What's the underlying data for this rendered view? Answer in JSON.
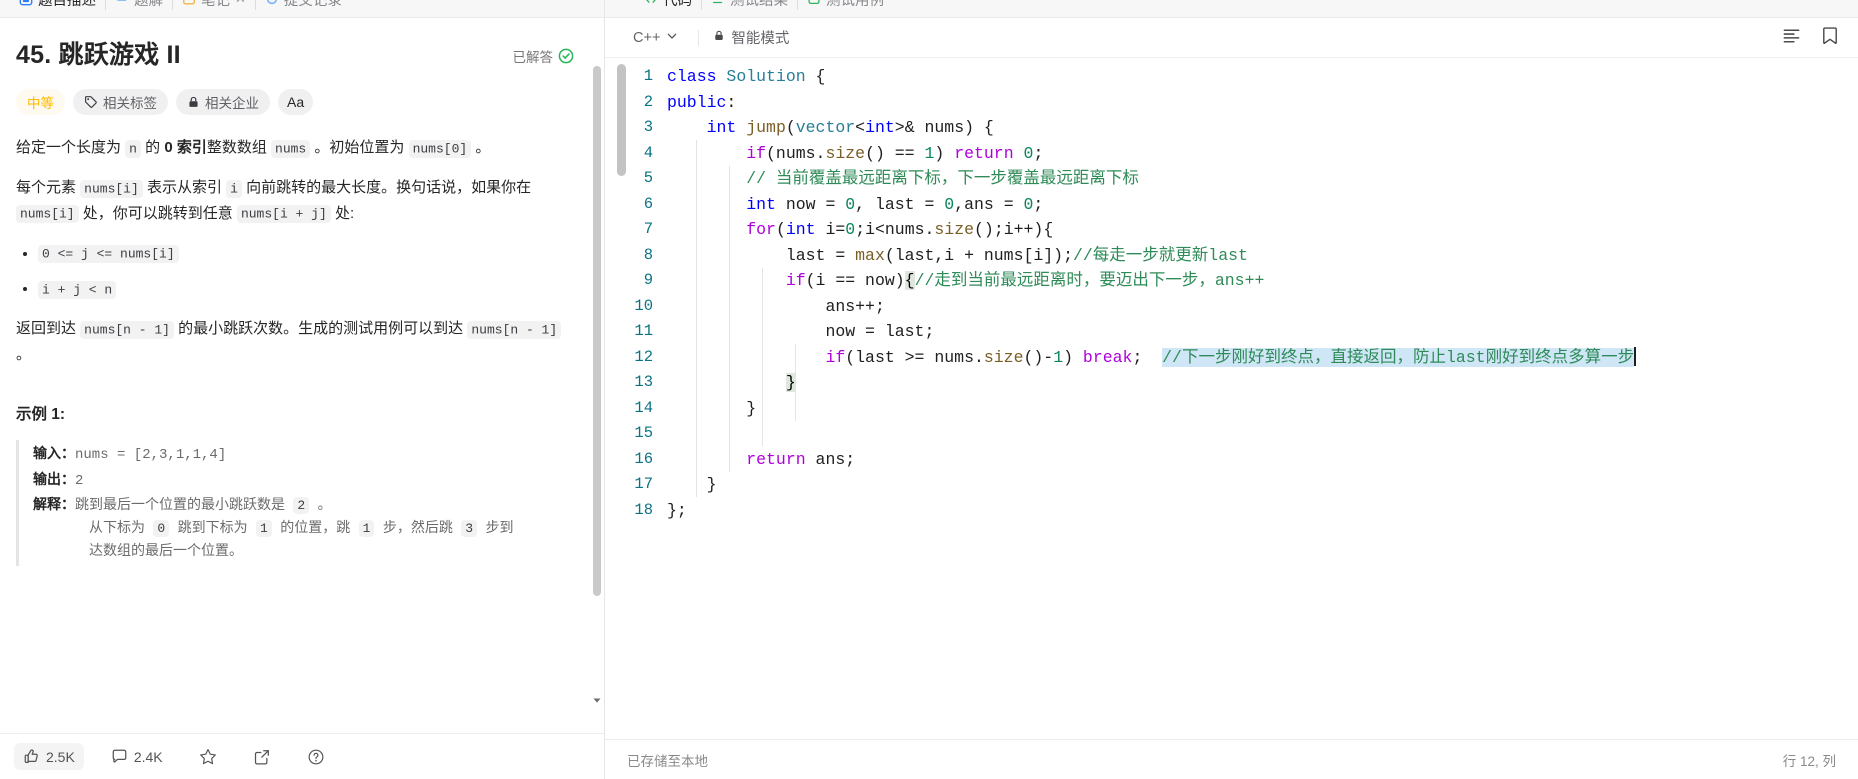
{
  "left_tabs": [
    {
      "label": "题目描述",
      "icon": "description-icon",
      "active": true
    },
    {
      "label": "题解",
      "icon": "solution-icon",
      "active": false
    },
    {
      "label": "笔记",
      "icon": "note-icon",
      "active": false
    },
    {
      "label": "提交记录",
      "icon": "history-icon",
      "active": false
    }
  ],
  "right_tabs": [
    {
      "label": "代码",
      "icon": "code-icon",
      "active": true
    },
    {
      "label": "测试结果",
      "icon": "test-result-icon",
      "active": false
    },
    {
      "label": "测试用例",
      "icon": "test-case-icon",
      "active": false
    }
  ],
  "problem": {
    "title": "45. 跳跃游戏 II",
    "solved_label": "已解答",
    "badges": [
      {
        "label": "中等",
        "icon": null,
        "kind": "difficulty"
      },
      {
        "label": "相关标签",
        "icon": "tag-icon",
        "kind": "normal"
      },
      {
        "label": "相关企业",
        "icon": "lock-icon",
        "kind": "normal"
      },
      {
        "label": "Aa",
        "icon": null,
        "kind": "font"
      }
    ],
    "paragraph1": {
      "t1": "给定一个长度为 ",
      "c1": "n",
      "t2": " 的 ",
      "b1": "0 索引",
      "t3": "整数数组 ",
      "c2": "nums",
      "t4": " 。初始位置为 ",
      "c3": "nums[0]",
      "t5": " 。"
    },
    "paragraph2": {
      "t1": "每个元素 ",
      "c1": "nums[i]",
      "t2": " 表示从索引 ",
      "c2": "i",
      "t3": " 向前跳转的最大长度。换句话说，如果你在 ",
      "c3": "nums[i]",
      "t4": " 处，你可以跳转到任意 ",
      "c4": "nums[i + j]",
      "t5": " 处:"
    },
    "bullets": [
      "0 <= j <= nums[i]",
      "i + j < n"
    ],
    "paragraph3": {
      "t1": "返回到达 ",
      "c1": "nums[n - 1]",
      "t2": " 的最小跳跃次数。生成的测试用例可以到达 ",
      "c2": "nums[n - 1]",
      "t3": " 。"
    },
    "example_title": "示例 1:",
    "example": {
      "input_label": "输入：",
      "input_value": "nums = [2,3,1,1,4]",
      "output_label": "输出：",
      "output_value": "2",
      "explain_label": "解释：",
      "explain_line1_a": "跳到最后一个位置的最小跳跃数是 ",
      "explain_line1_chip": "2",
      "explain_line1_b": " 。",
      "explain_line2_a": "从下标为 ",
      "explain_line2_c1": "0",
      "explain_line2_b": " 跳到下标为 ",
      "explain_line2_c2": "1",
      "explain_line2_c": " 的位置，跳 ",
      "explain_line2_c3": "1",
      "explain_line2_d": " 步，然后跳 ",
      "explain_line2_c4": "3",
      "explain_line2_e": " 步到",
      "explain_line3": "达数组的最后一个位置。"
    }
  },
  "footer": {
    "likes": "2.5K",
    "comments": "2.4K",
    "star_icon": "star-icon",
    "share_icon": "share-icon",
    "help_icon": "help-icon"
  },
  "editor": {
    "language": "C++",
    "smart_mode": "智能模式",
    "lock_icon": "lock-icon",
    "chevron_icon": "chevron-down-icon",
    "format_icon": "format-list-icon",
    "bookmark_icon": "bookmark-icon",
    "status_left": "已存储至本地",
    "status_right": "行 12, 列"
  },
  "code_lines": [
    {
      "n": "1",
      "tokens": [
        {
          "t": "class ",
          "c": "kw"
        },
        {
          "t": "Solution",
          "c": "typ"
        },
        {
          "t": " {",
          "c": "pl"
        }
      ]
    },
    {
      "n": "2",
      "tokens": [
        {
          "t": "public",
          "c": "kw"
        },
        {
          "t": ":",
          "c": "pl"
        }
      ]
    },
    {
      "n": "3",
      "tokens": [
        {
          "t": "    ",
          "c": "pl"
        },
        {
          "t": "int",
          "c": "kw"
        },
        {
          "t": " ",
          "c": "pl"
        },
        {
          "t": "jump",
          "c": "fn"
        },
        {
          "t": "(",
          "c": "pl"
        },
        {
          "t": "vector",
          "c": "typ"
        },
        {
          "t": "<",
          "c": "pl"
        },
        {
          "t": "int",
          "c": "kw"
        },
        {
          "t": ">& nums) {",
          "c": "pl"
        }
      ]
    },
    {
      "n": "4",
      "tokens": [
        {
          "t": "        ",
          "c": "pl"
        },
        {
          "t": "if",
          "c": "ctrl"
        },
        {
          "t": "(nums.",
          "c": "pl"
        },
        {
          "t": "size",
          "c": "fn"
        },
        {
          "t": "() == ",
          "c": "pl"
        },
        {
          "t": "1",
          "c": "num"
        },
        {
          "t": ") ",
          "c": "pl"
        },
        {
          "t": "return",
          "c": "ctrl"
        },
        {
          "t": " ",
          "c": "pl"
        },
        {
          "t": "0",
          "c": "num"
        },
        {
          "t": ";",
          "c": "pl"
        }
      ]
    },
    {
      "n": "5",
      "tokens": [
        {
          "t": "        ",
          "c": "pl"
        },
        {
          "t": "// 当前覆盖最远距离下标，下一步覆盖最远距离下标",
          "c": "cmt"
        }
      ]
    },
    {
      "n": "6",
      "tokens": [
        {
          "t": "        ",
          "c": "pl"
        },
        {
          "t": "int",
          "c": "kw"
        },
        {
          "t": " now = ",
          "c": "pl"
        },
        {
          "t": "0",
          "c": "num"
        },
        {
          "t": ", last = ",
          "c": "pl"
        },
        {
          "t": "0",
          "c": "num"
        },
        {
          "t": ",ans = ",
          "c": "pl"
        },
        {
          "t": "0",
          "c": "num"
        },
        {
          "t": ";",
          "c": "pl"
        }
      ]
    },
    {
      "n": "7",
      "tokens": [
        {
          "t": "        ",
          "c": "pl"
        },
        {
          "t": "for",
          "c": "ctrl"
        },
        {
          "t": "(",
          "c": "pl"
        },
        {
          "t": "int",
          "c": "kw"
        },
        {
          "t": " i=",
          "c": "pl"
        },
        {
          "t": "0",
          "c": "num"
        },
        {
          "t": ";i<nums.",
          "c": "pl"
        },
        {
          "t": "size",
          "c": "fn"
        },
        {
          "t": "();i++){",
          "c": "pl"
        }
      ]
    },
    {
      "n": "8",
      "tokens": [
        {
          "t": "            last = ",
          "c": "pl"
        },
        {
          "t": "max",
          "c": "fn"
        },
        {
          "t": "(last,i + nums[i]);",
          "c": "pl"
        },
        {
          "t": "//每走一步就更新last",
          "c": "cmt"
        }
      ]
    },
    {
      "n": "9",
      "tokens": [
        {
          "t": "            ",
          "c": "pl"
        },
        {
          "t": "if",
          "c": "ctrl"
        },
        {
          "t": "(i == now)",
          "c": "pl"
        },
        {
          "t": "{",
          "c": "brkt"
        },
        {
          "t": "//走到当前最远距离时，要迈出下一步，ans++",
          "c": "cmt"
        }
      ]
    },
    {
      "n": "10",
      "tokens": [
        {
          "t": "                ans++;",
          "c": "pl"
        }
      ]
    },
    {
      "n": "11",
      "tokens": [
        {
          "t": "                now = last;",
          "c": "pl"
        }
      ]
    },
    {
      "n": "12",
      "tokens": [
        {
          "t": "                ",
          "c": "pl"
        },
        {
          "t": "if",
          "c": "ctrl"
        },
        {
          "t": "(last >= nums.",
          "c": "pl"
        },
        {
          "t": "size",
          "c": "fn"
        },
        {
          "t": "()-",
          "c": "pl"
        },
        {
          "t": "1",
          "c": "num"
        },
        {
          "t": ") ",
          "c": "pl"
        },
        {
          "t": "break",
          "c": "ctrl"
        },
        {
          "t": ";  ",
          "c": "pl"
        },
        {
          "t": "//下一步刚好到终点，直接返回，防止last刚好到终点多算一步",
          "c": "cmt sel"
        }
      ],
      "caret": true
    },
    {
      "n": "13",
      "tokens": [
        {
          "t": "            ",
          "c": "pl"
        },
        {
          "t": "}",
          "c": "brkt"
        }
      ]
    },
    {
      "n": "14",
      "tokens": [
        {
          "t": "        }",
          "c": "pl"
        }
      ]
    },
    {
      "n": "15",
      "tokens": [
        {
          "t": "",
          "c": "pl"
        }
      ]
    },
    {
      "n": "16",
      "tokens": [
        {
          "t": "        ",
          "c": "pl"
        },
        {
          "t": "return",
          "c": "ctrl"
        },
        {
          "t": " ans;",
          "c": "pl"
        }
      ]
    },
    {
      "n": "17",
      "tokens": [
        {
          "t": "    }",
          "c": "pl"
        }
      ]
    },
    {
      "n": "18",
      "tokens": [
        {
          "t": "};",
          "c": "pl"
        }
      ]
    }
  ]
}
